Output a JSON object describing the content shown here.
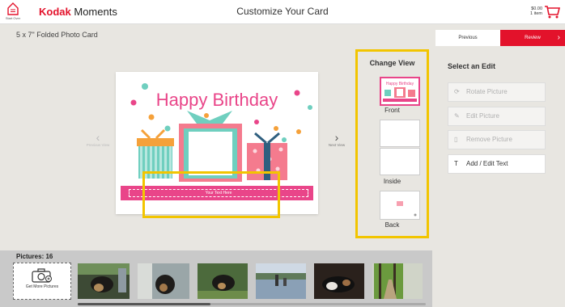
{
  "header": {
    "home_label": "Start Over",
    "brand_kodak": "Kodak",
    "brand_moments": "Moments",
    "title": "Customize Your Card",
    "cart_price": "$0.00",
    "cart_items": "1 item"
  },
  "product": {
    "name": "5 x 7\" Folded Photo Card"
  },
  "card": {
    "headline": "Happy Birthday",
    "text_placeholder": "Your Text Here"
  },
  "nav": {
    "prev_label": "Previous View",
    "next_label": "Next View"
  },
  "change_view": {
    "title": "Change View",
    "views": [
      {
        "label": "Front"
      },
      {
        "label": "Inside"
      },
      {
        "label": "Back"
      }
    ]
  },
  "actions": {
    "previous": "Previous",
    "review": "Review"
  },
  "edit": {
    "title": "Select an Edit",
    "buttons": [
      {
        "label": "Rotate Picture",
        "icon": "rotate-icon"
      },
      {
        "label": "Edit Picture",
        "icon": "edit-icon"
      },
      {
        "label": "Remove Picture",
        "icon": "trash-icon"
      },
      {
        "label": "Add / Edit Text",
        "icon": "text-icon"
      }
    ]
  },
  "pictures": {
    "title": "Pictures: 16",
    "get_more": "Get More Pictures"
  },
  "colors": {
    "brand_red": "#e3122b",
    "highlight_yellow": "#f2c500",
    "card_pink": "#e94589",
    "card_teal": "#6fcfbf"
  }
}
